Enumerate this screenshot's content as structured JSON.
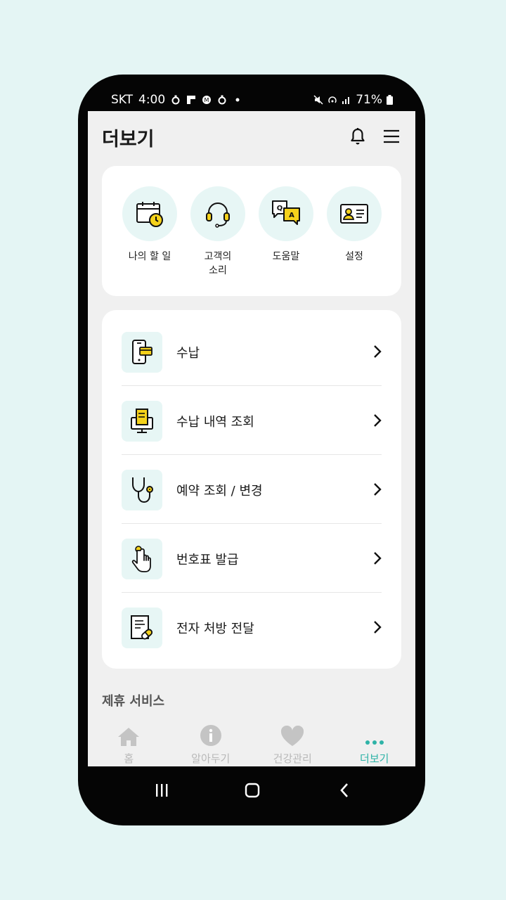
{
  "status_bar": {
    "carrier": "SKT",
    "time": "4:00",
    "battery": "71%"
  },
  "header": {
    "title": "더보기"
  },
  "quick_menu": [
    {
      "label": "나의 할 일",
      "icon": "calendar-clock-icon"
    },
    {
      "label": "고객의\n소리",
      "icon": "headset-icon"
    },
    {
      "label": "도움말",
      "icon": "qa-bubble-icon"
    },
    {
      "label": "설정",
      "icon": "id-card-icon"
    }
  ],
  "menu_items": [
    {
      "label": "수납",
      "icon": "mobile-payment-icon"
    },
    {
      "label": "수납 내역 조회",
      "icon": "receipt-monitor-icon"
    },
    {
      "label": "예약 조회 / 변경",
      "icon": "stethoscope-icon"
    },
    {
      "label": "번호표 발급",
      "icon": "tap-finger-icon"
    },
    {
      "label": "전자 처방 전달",
      "icon": "prescription-pill-icon"
    }
  ],
  "section": {
    "partner_services": "제휴 서비스"
  },
  "tabs": [
    {
      "label": "홈",
      "icon": "home-icon",
      "active": false
    },
    {
      "label": "알아두기",
      "icon": "info-icon",
      "active": false
    },
    {
      "label": "건강관리",
      "icon": "heart-icon",
      "active": false
    },
    {
      "label": "더보기",
      "icon": "more-dots-icon",
      "active": true
    }
  ],
  "colors": {
    "accent": "#2fb3a7",
    "icon_bg": "#e7f6f5",
    "highlight": "#f5d21b",
    "page_bg": "#e4f5f4"
  }
}
